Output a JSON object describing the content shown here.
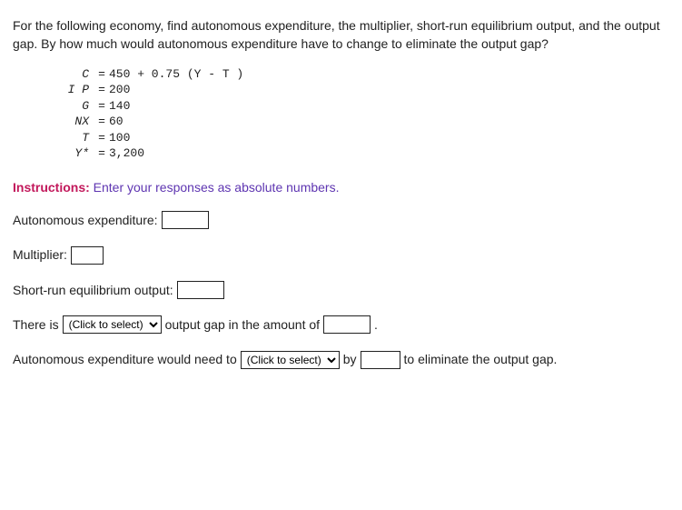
{
  "question": "For the following economy, find autonomous expenditure, the multiplier, short-run equilibrium output, and the output gap. By how much would autonomous expenditure have to change to eliminate the output gap?",
  "equations": [
    {
      "var": "C",
      "val": "450 + 0.75 (Y - T )"
    },
    {
      "var": "I P",
      "val": "200"
    },
    {
      "var": "G",
      "val": "140"
    },
    {
      "var": "NX",
      "val": "60"
    },
    {
      "var": "T",
      "val": "100"
    },
    {
      "var": "Y*",
      "val": "3,200"
    }
  ],
  "instructions": {
    "label": "Instructions:",
    "text": " Enter your responses as absolute numbers."
  },
  "lines": {
    "ae_label": "Autonomous expenditure:",
    "multiplier_label": "Multiplier:",
    "sre_label": "Short-run equilibrium output:",
    "gap_pre": "There is",
    "gap_mid": "output  gap in the amount of",
    "gap_post": ".",
    "change_pre": "Autonomous expenditure would need to",
    "change_by": "by",
    "change_post": "to eliminate the output gap."
  },
  "dropdown_placeholder": "(Click to select)"
}
